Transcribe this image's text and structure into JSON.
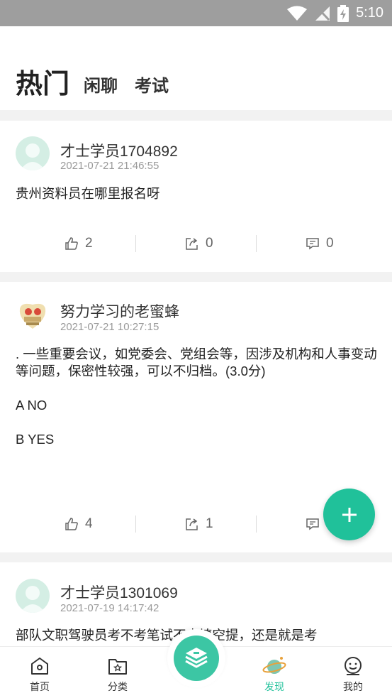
{
  "status_bar": {
    "time": "5:10",
    "icons": [
      "wifi-icon",
      "no-signal-icon",
      "battery-charging-icon"
    ]
  },
  "header": {
    "tabs": [
      "热门",
      "闲聊",
      "考试"
    ]
  },
  "posts": [
    {
      "author": "才士学员1704892",
      "time": "2021-07-21 21:46:55",
      "content": [
        "贵州资料员在哪里报名呀"
      ],
      "likes": "2",
      "shares": "0",
      "comments": "0"
    },
    {
      "author": "努力学习的老蜜蜂",
      "time": "2021-07-21 10:27:15",
      "content": [
        ". 一些重要会议，如党委会、党组会等，因涉及机构和人事变动等问题，保密性较强，可以不归档。(3.0分)",
        "A NO",
        "B YES"
      ],
      "likes": "4",
      "shares": "1",
      "comments": ""
    },
    {
      "author": "才士学员1301069",
      "time": "2021-07-19 14:17:42",
      "content": [
        "部队文职驾驶员考不考笔试不去填空提，还是就是考"
      ]
    }
  ],
  "fab": {
    "icon": "plus-icon"
  },
  "bottom_nav": {
    "items": [
      {
        "label": "首页",
        "icon": "home-icon"
      },
      {
        "label": "分类",
        "icon": "category-folder-icon"
      },
      {
        "label": "发现",
        "icon": "planet-icon",
        "active": true
      },
      {
        "label": "我的",
        "icon": "profile-icon"
      }
    ],
    "center_icon": "book-stack-icon"
  },
  "colors": {
    "accent": "#20c19a",
    "status_bar": "#9e9e9e",
    "separator": "#f2f2f2"
  }
}
